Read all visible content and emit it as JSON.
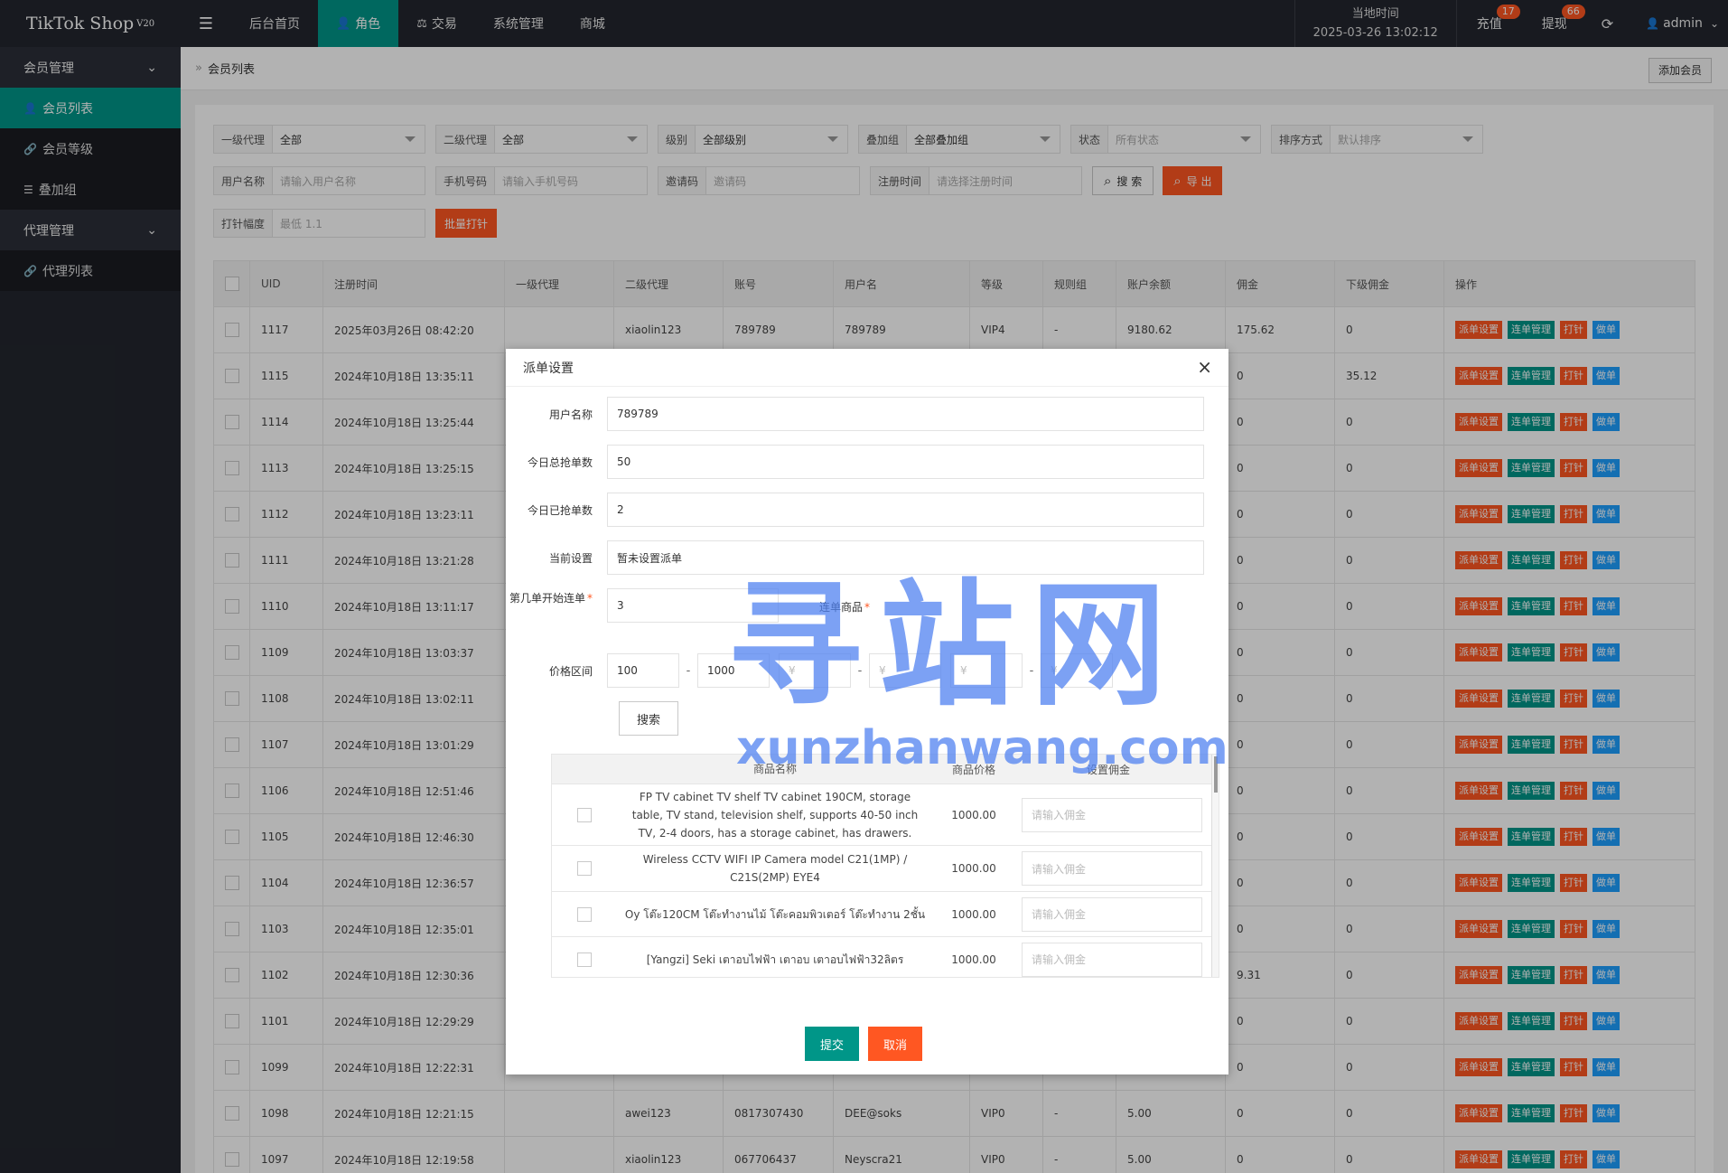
{
  "app": {
    "brand": "TikTok Shop",
    "version": "V20",
    "menu_icon": "☰",
    "nav": [
      {
        "label": "后台首页",
        "icon": ""
      },
      {
        "label": "角色",
        "icon": "👤"
      },
      {
        "label": "交易",
        "icon": "⚖"
      },
      {
        "label": "系统管理",
        "icon": ""
      },
      {
        "label": "商城",
        "icon": ""
      }
    ],
    "clock_label": "当地时间",
    "clock_value": "2025-03-26 13:02:12",
    "recharge_label": "充值",
    "recharge_badge": "17",
    "withdraw_label": "提现",
    "withdraw_badge": "66",
    "refresh_icon": "⟳",
    "user_icon": "👤",
    "user_name": "admin",
    "user_chevron": "⌄"
  },
  "sidebar": {
    "groups": [
      {
        "label": "会员管理",
        "chevron": "⌄",
        "items": [
          {
            "label": "会员列表",
            "icon": "👤"
          },
          {
            "label": "会员等级",
            "icon": "🔗"
          },
          {
            "label": "叠加组",
            "icon": "☰"
          }
        ]
      },
      {
        "label": "代理管理",
        "chevron": "⌄",
        "items": [
          {
            "label": "代理列表",
            "icon": "🔗"
          }
        ]
      }
    ]
  },
  "breadcrumb": {
    "sep": "»",
    "title": "会员列表",
    "add_button": "添加会员"
  },
  "filters": {
    "agent1": {
      "label": "一级代理",
      "value": "全部"
    },
    "agent2": {
      "label": "二级代理",
      "value": "全部"
    },
    "level": {
      "label": "级别",
      "value": "全部级别"
    },
    "group": {
      "label": "叠加组",
      "value": "全部叠加组"
    },
    "status": {
      "label": "状态",
      "value": "所有状态"
    },
    "sort": {
      "label": "排序方式",
      "value": "默认排序"
    },
    "username": {
      "label": "用户名称",
      "placeholder": "请输入用户名称"
    },
    "phone": {
      "label": "手机号码",
      "placeholder": "请输入手机号码"
    },
    "invite": {
      "label": "邀请码",
      "placeholder": "邀请码"
    },
    "regtime": {
      "label": "注册时间",
      "placeholder": "请选择注册时间"
    },
    "search_button": "搜 索",
    "search_icon": "⌕",
    "export_button": "导 出",
    "export_icon": "⌕",
    "range": {
      "label": "打针幅度",
      "placeholder": "最低 1.1"
    },
    "batch_button": "批量打针"
  },
  "table": {
    "headers": [
      "UID",
      "注册时间",
      "一级代理",
      "二级代理",
      "账号",
      "用户名",
      "等级",
      "规则组",
      "账户余额",
      "佣金",
      "下级佣金",
      "操作"
    ],
    "ops": [
      "派单设置",
      "连单管理",
      "打针",
      "做单"
    ],
    "rows": [
      [
        "1117",
        "2025年03月26日 08:42:20",
        "",
        "xiaolin123",
        "789789",
        "789789",
        "VIP4",
        "-",
        "9180.62",
        "175.62",
        "0"
      ],
      [
        "1115",
        "2024年10月18日 13:35:11",
        "",
        "",
        "",
        "",
        "",
        "",
        "",
        "0",
        "35.12"
      ],
      [
        "1114",
        "2024年10月18日 13:25:44",
        "",
        "",
        "",
        "",
        "",
        "",
        "",
        "0",
        "0"
      ],
      [
        "1113",
        "2024年10月18日 13:25:15",
        "",
        "",
        "",
        "",
        "",
        "",
        "",
        "0",
        "0"
      ],
      [
        "1112",
        "2024年10月18日 13:23:11",
        "",
        "",
        "",
        "",
        "",
        "",
        "",
        "0",
        "0"
      ],
      [
        "1111",
        "2024年10月18日 13:21:28",
        "",
        "",
        "",
        "",
        "",
        "",
        "",
        "0",
        "0"
      ],
      [
        "1110",
        "2024年10月18日 13:11:17",
        "",
        "",
        "",
        "",
        "",
        "",
        "",
        "0",
        "0"
      ],
      [
        "1109",
        "2024年10月18日 13:03:37",
        "",
        "",
        "",
        "",
        "",
        "",
        "",
        "0",
        "0"
      ],
      [
        "1108",
        "2024年10月18日 13:02:11",
        "",
        "",
        "",
        "",
        "",
        "",
        "",
        "0",
        "0"
      ],
      [
        "1107",
        "2024年10月18日 13:01:29",
        "",
        "",
        "",
        "",
        "",
        "",
        "",
        "0",
        "0"
      ],
      [
        "1106",
        "2024年10月18日 12:51:46",
        "",
        "",
        "",
        "",
        "",
        "",
        "",
        "0",
        "0"
      ],
      [
        "1105",
        "2024年10月18日 12:46:30",
        "",
        "",
        "",
        "",
        "",
        "",
        "",
        "0",
        "0"
      ],
      [
        "1104",
        "2024年10月18日 12:36:57",
        "",
        "",
        "",
        "",
        "",
        "",
        "",
        "0",
        "0"
      ],
      [
        "1103",
        "2024年10月18日 12:35:01",
        "",
        "",
        "",
        "",
        "",
        "",
        "",
        "0",
        "0"
      ],
      [
        "1102",
        "2024年10月18日 12:30:36",
        "",
        "",
        "",
        "",
        "",
        "",
        "",
        "9.31",
        "0"
      ],
      [
        "1101",
        "2024年10月18日 12:29:29",
        "",
        "",
        "",
        "",
        "",
        "",
        "",
        "0",
        "0"
      ],
      [
        "1099",
        "2024年10月18日 12:22:31",
        "",
        "",
        "",
        "",
        "",
        "",
        "",
        "0",
        "0"
      ],
      [
        "1098",
        "2024年10月18日 12:21:15",
        "",
        "awei123",
        "0817307430",
        "DEE@soks",
        "VIP0",
        "-",
        "5.00",
        "0",
        "0"
      ],
      [
        "1097",
        "2024年10月18日 12:19:58",
        "",
        "xiaolin123",
        "067706437",
        "Neyscra21",
        "VIP0",
        "-",
        "5.00",
        "0",
        "0"
      ]
    ]
  },
  "modal": {
    "title": "派单设置",
    "close_icon": "×",
    "username_label": "用户名称",
    "username_value": "789789",
    "today_total_label": "今日总抢单数",
    "today_total_value": "50",
    "today_done_label": "今日已抢单数",
    "today_done_value": "2",
    "current_label": "当前设置",
    "current_value": "暂未设置派单",
    "start_label": "第几单开始连单",
    "start_value": "3",
    "required_mark": "*",
    "goods_label": "连单商品",
    "price_label": "价格区间",
    "price_min": "100",
    "price_max": "1000",
    "dash": "-",
    "currency_ph": "¥",
    "search_button": "搜索",
    "goods_headers": [
      "商品名称",
      "商品价格",
      "设置佣金"
    ],
    "goods": [
      {
        "name": "FP TV cabinet TV shelf TV cabinet 190CM, storage table, TV stand, television shelf, supports 40-50 inch TV, 2-4 doors, has a storage cabinet, has drawers.",
        "price": "1000.00"
      },
      {
        "name": "Wireless CCTV WIFI IP Camera model C21(1MP) / C21S(2MP) EYE4",
        "price": "1000.00"
      },
      {
        "name": "Oy โต๊ะ120CM โต๊ะทำงานไม้ โต๊ะคอมพิวเตอร์ โต๊ะทำงาน 2ชั้น",
        "price": "1000.00"
      },
      {
        "name": "[Yangzi] Seki เตาอบไฟฟ้า เตาอบ เตาอบไฟฟ้า32ลิตร",
        "price": "1000.00"
      }
    ],
    "commission_placeholder": "请输入佣金",
    "submit_button": "提交",
    "cancel_button": "取消"
  },
  "watermark": {
    "cn": "寻站网",
    "en": "xunzhanwang.com"
  }
}
